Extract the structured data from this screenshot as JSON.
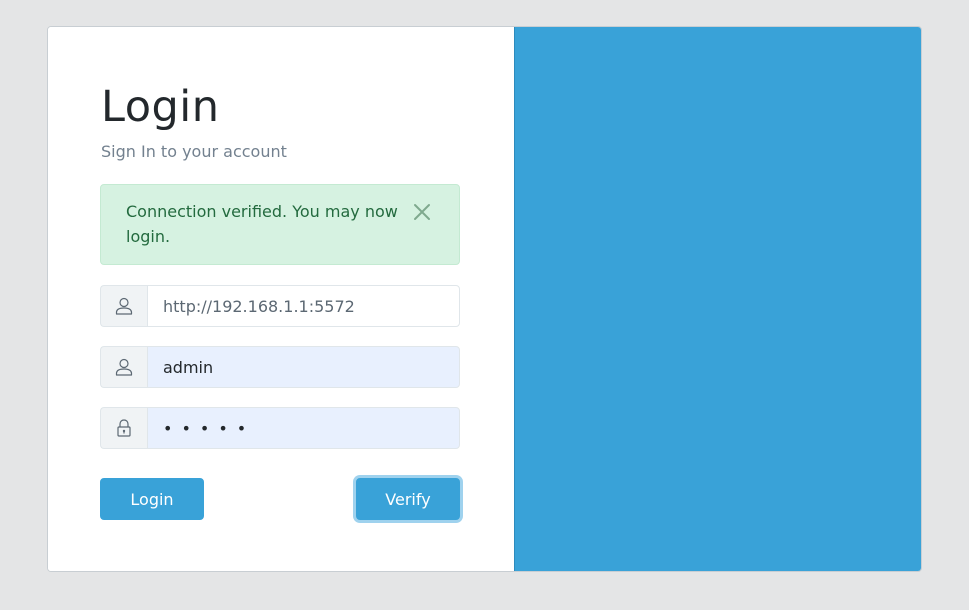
{
  "login": {
    "title": "Login",
    "subtitle": "Sign In to your account"
  },
  "alert": {
    "message": "Connection verified. You may now login.",
    "close_icon": "close-icon",
    "color": "#236a3e",
    "background": "#d6f2e1"
  },
  "form": {
    "url": {
      "value": "http://192.168.1.1:5572",
      "icon": "user-icon"
    },
    "username": {
      "value": "admin",
      "icon": "user-icon"
    },
    "password": {
      "value": "•••••",
      "icon": "lock-icon"
    }
  },
  "buttons": {
    "login_label": "Login",
    "verify_label": "Verify"
  },
  "colors": {
    "primary": "#39a2d8",
    "page_background": "#e4e5e6"
  }
}
